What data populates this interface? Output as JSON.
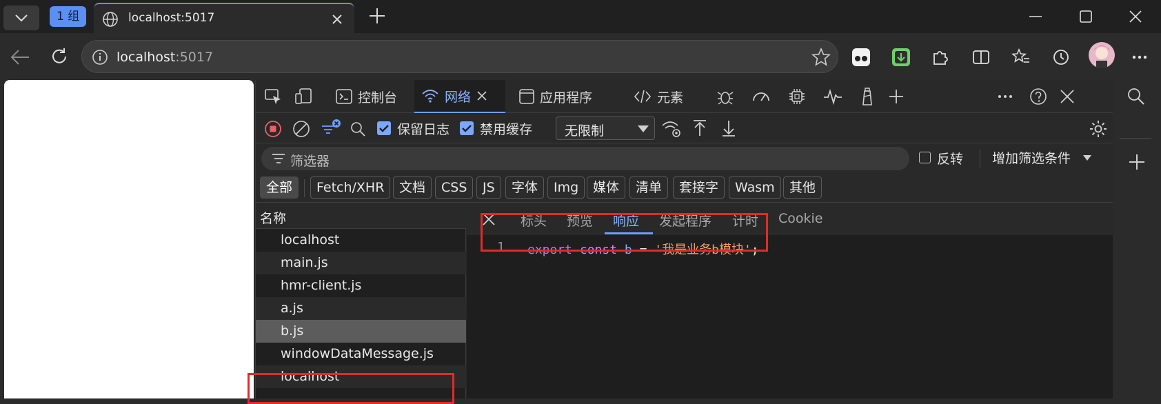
{
  "tabstrip": {
    "group_label": "1 组",
    "active_tab_title": "localhost:5017"
  },
  "toolbar": {
    "url_host": "localhost",
    "url_port": ":5017"
  },
  "devtools": {
    "tabs": {
      "console": "控制台",
      "network": "网络",
      "application": "应用程序",
      "elements": "元素"
    },
    "controls": {
      "preserve_log": "保留日志",
      "disable_cache": "禁用缓存",
      "throttling": "无限制"
    },
    "filter": {
      "placeholder": "筛选器",
      "invert": "反转",
      "more_filters": "增加筛选条件"
    },
    "types": [
      "全部",
      "Fetch/XHR",
      "文档",
      "CSS",
      "JS",
      "字体",
      "Img",
      "媒体",
      "清单",
      "套接字",
      "Wasm",
      "其他"
    ],
    "list_header": "名称",
    "requests": [
      "localhost",
      "main.js",
      "hmr-client.js",
      "a.js",
      "b.js",
      "windowDataMessage.js",
      "localhost"
    ],
    "detail_tabs": [
      "标头",
      "预览",
      "响应",
      "发起程序",
      "计时",
      "Cookie"
    ],
    "response": {
      "line_number": "1",
      "kw_export": "export",
      "kw_const": "const",
      "ident": "b",
      "op": "=",
      "string": "'我是业务b模块'",
      "semicolon": ";"
    }
  },
  "colors": {
    "accent": "#6ea0ff",
    "highlight_box": "#e02b2b"
  }
}
